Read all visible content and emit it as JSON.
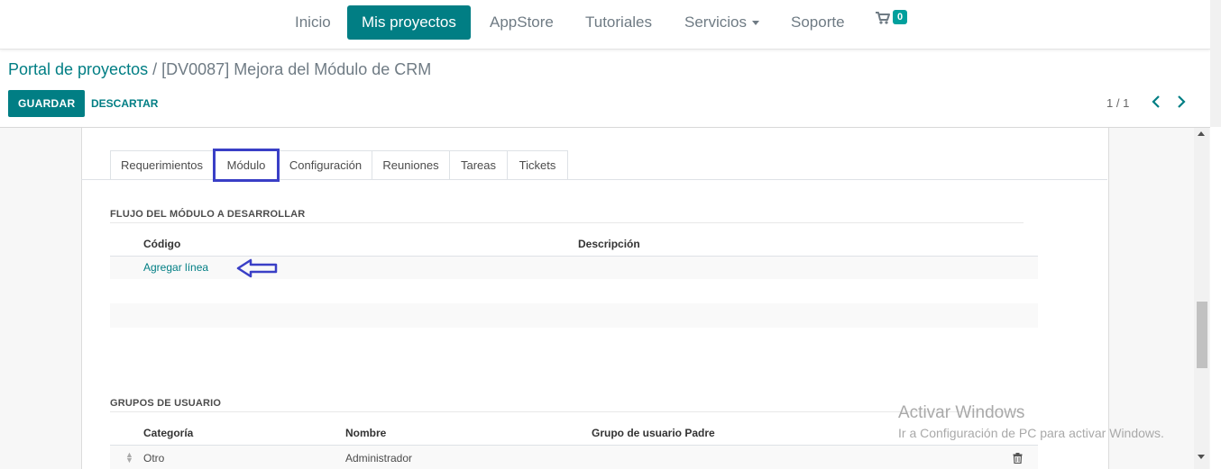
{
  "colors": {
    "primary": "#017e84",
    "badge": "#00a09d",
    "highlight": "#3a3fc6"
  },
  "topnav": {
    "items": [
      {
        "label": "Inicio"
      },
      {
        "label": "Mis proyectos",
        "active": true
      },
      {
        "label": "AppStore"
      },
      {
        "label": "Tutoriales"
      },
      {
        "label": "Servicios"
      },
      {
        "label": "Soporte"
      }
    ],
    "cart_icon": "shopping-cart-icon",
    "cart_count": "0"
  },
  "breadcrumb": {
    "parent": "Portal de proyectos",
    "separator": "/",
    "current": "[DV0087] Mejora del Módulo de CRM"
  },
  "control_panel": {
    "save_label": "GUARDAR",
    "discard_label": "DESCARTAR",
    "pager": "1 / 1",
    "prev_icon": "chevron-left-icon",
    "next_icon": "chevron-right-icon"
  },
  "tabs": [
    {
      "label": "Requerimientos"
    },
    {
      "label": "Módulo",
      "active": true
    },
    {
      "label": "Configuración"
    },
    {
      "label": "Reuniones"
    },
    {
      "label": "Tareas"
    },
    {
      "label": "Tickets"
    }
  ],
  "flujo": {
    "title": "FLUJO DEL MÓDULO A DESARROLLAR",
    "columns": [
      "Código",
      "Descripción"
    ],
    "add_line": "Agregar línea"
  },
  "grupos": {
    "title": "GRUPOS DE USUARIO",
    "columns": [
      "Categoría",
      "Nombre",
      "Grupo de usuario Padre"
    ],
    "rows": [
      {
        "categoria": "Otro",
        "nombre": "Administrador",
        "padre": ""
      }
    ]
  },
  "watermark": {
    "title": "Activar Windows",
    "subtitle": "Ir a Configuración de PC para activar Windows."
  }
}
